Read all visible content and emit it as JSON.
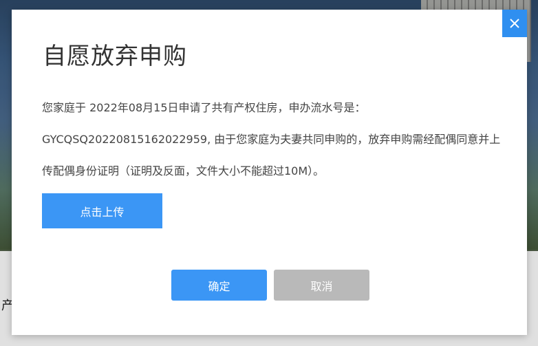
{
  "dialog": {
    "title": "自愿放弃申购",
    "message": "您家庭于 2022年08月15日申请了共有产权住房，申办流水号是：GYCQSQ20220815162022959, 由于您家庭为夫妻共同申购的，放弃申购需经配偶同意并上传配偶身份证明（证明及反面，文件大小不能超过10M）。",
    "upload_label": "点击上传",
    "confirm_label": "确定",
    "cancel_label": "取消",
    "close_icon": "close-icon"
  },
  "background": {
    "partial_text": "产"
  },
  "colors": {
    "primary": "#3b96f5",
    "close": "#2f8ff0",
    "disabled": "#b9b9b9",
    "text": "#444444"
  }
}
